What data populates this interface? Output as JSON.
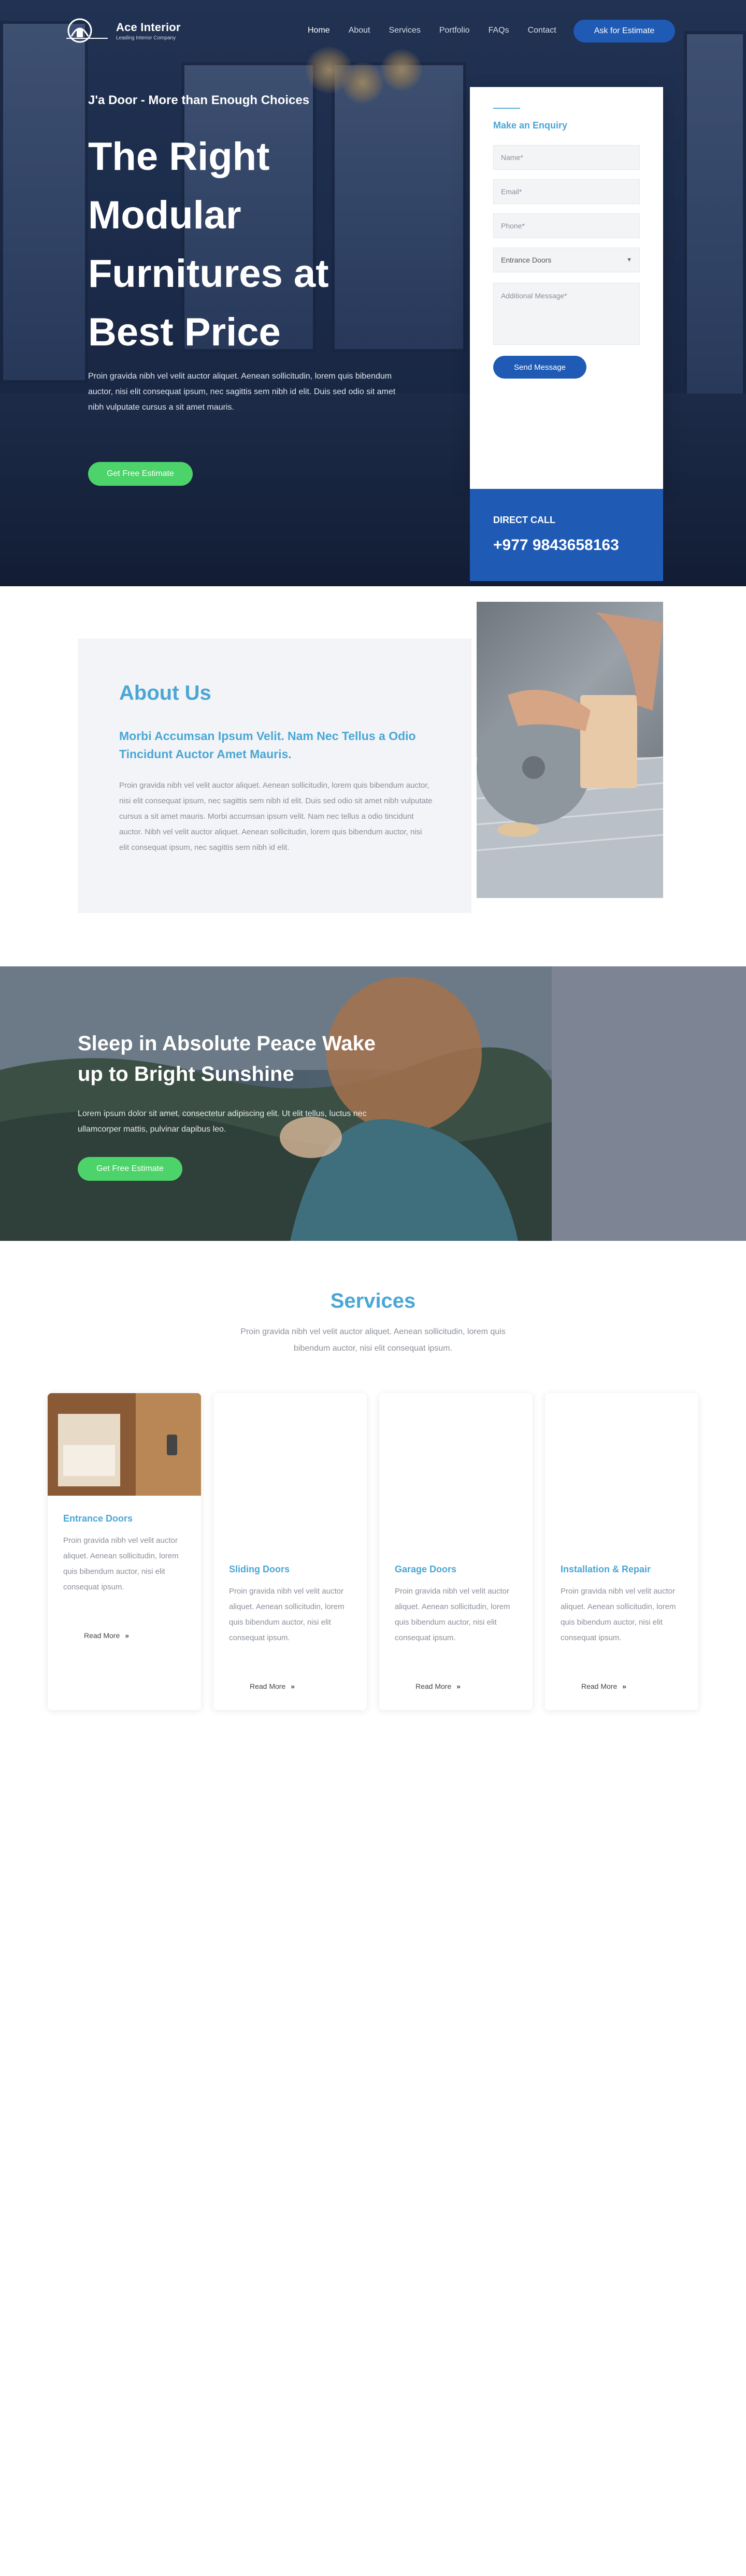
{
  "brand": {
    "name": "Ace Interior",
    "tagline": "Leading Interior Company"
  },
  "nav": {
    "items": [
      "Home",
      "About",
      "Services",
      "Portfolio",
      "FAQs",
      "Contact"
    ],
    "cta": "Ask for Estimate"
  },
  "hero": {
    "kicker": "J'a Door - More than Enough Choices",
    "title": "The Right Modular Furnitures at Best Price",
    "description": "Proin gravida nibh vel velit auctor aliquet. Aenean sollicitudin, lorem quis bibendum auctor, nisi elit consequat ipsum, nec sagittis sem nibh id elit. Duis sed odio sit amet nibh vulputate cursus a sit amet mauris.",
    "cta": "Get Free Estimate"
  },
  "enquiry": {
    "title": "Make an Enquiry",
    "name_placeholder": "Name*",
    "email_placeholder": "Email*",
    "phone_placeholder": "Phone*",
    "select_value": "Entrance Doors",
    "message_placeholder": "Additional Message*",
    "submit": "Send Message",
    "direct_label": "DIRECT CALL",
    "direct_phone": "+977 9843658163"
  },
  "about": {
    "title": "About Us",
    "subtitle": "Morbi Accumsan Ipsum Velit. Nam Nec Tellus a Odio Tincidunt Auctor Amet Mauris.",
    "description": "Proin gravida nibh vel velit auctor aliquet. Aenean sollicitudin, lorem quis bibendum auctor, nisi elit consequat ipsum, nec sagittis sem nibh id elit. Duis sed odio sit amet nibh vulputate cursus a sit amet mauris. Morbi accumsan ipsum velit. Nam nec tellus a odio tincidunt auctor. Nibh vel velit auctor aliquet. Aenean sollicitudin, lorem quis bibendum auctor, nisi elit consequat ipsum, nec sagittis sem nibh id elit."
  },
  "banner": {
    "title": "Sleep in Absolute Peace Wake up to Bright Sunshine",
    "description": "Lorem ipsum dolor sit amet, consectetur adipiscing elit. Ut elit tellus, luctus nec ullamcorper mattis, pulvinar dapibus leo.",
    "cta": "Get Free Estimate"
  },
  "services": {
    "title": "Services",
    "description": "Proin gravida nibh vel velit auctor aliquet. Aenean sollicitudin, lorem quis bibendum auctor, nisi elit consequat ipsum.",
    "cards": [
      {
        "title": "Entrance Doors",
        "description": "Proin gravida nibh vel velit auctor aliquet. Aenean sollicitudin, lorem quis bibendum auctor, nisi elit consequat ipsum.",
        "link": "Read More"
      },
      {
        "title": "Sliding Doors",
        "description": "Proin gravida nibh vel velit auctor aliquet. Aenean sollicitudin, lorem quis bibendum auctor, nisi elit consequat ipsum.",
        "link": "Read More"
      },
      {
        "title": "Garage Doors",
        "description": "Proin gravida nibh vel velit auctor aliquet. Aenean sollicitudin, lorem quis bibendum auctor, nisi elit consequat ipsum.",
        "link": "Read More"
      },
      {
        "title": "Installation & Repair",
        "description": "Proin gravida nibh vel velit auctor aliquet. Aenean sollicitudin, lorem quis bibendum auctor, nisi elit consequat ipsum.",
        "link": "Read More"
      }
    ]
  },
  "colors": {
    "accent": "#4aa6d5",
    "primary": "#1f5bb5",
    "cta_green": "#4cd36a"
  }
}
